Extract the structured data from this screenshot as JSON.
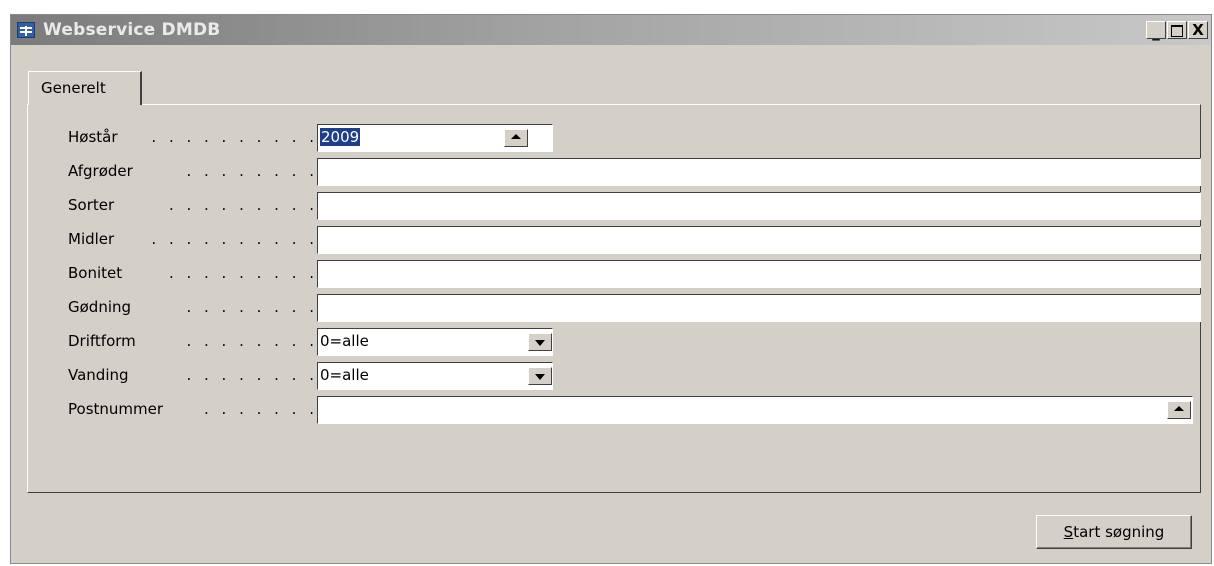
{
  "window": {
    "title": "Webservice DMDB",
    "controls": {
      "minimize": "_",
      "maximize": "□",
      "close": "X"
    }
  },
  "tabs": [
    {
      "label": "Generelt",
      "active": true
    }
  ],
  "form": {
    "hostaar": {
      "label": "Høstår",
      "value": "2009"
    },
    "afgroder": {
      "label": "Afgrøder",
      "value": ""
    },
    "sorter": {
      "label": "Sorter",
      "value": ""
    },
    "midler": {
      "label": "Midler",
      "value": ""
    },
    "bonitet": {
      "label": "Bonitet",
      "value": ""
    },
    "godning": {
      "label": "Gødning",
      "value": ""
    },
    "driftform": {
      "label": "Driftform",
      "value": "0=alle"
    },
    "vanding": {
      "label": "Vanding",
      "value": "0=alle"
    },
    "postnummer": {
      "label": "Postnummer",
      "value": ""
    }
  },
  "footer": {
    "start_button": {
      "accel": "S",
      "rest": "tart søgning"
    }
  },
  "icons": {
    "lookup": "lookup-arrow-icon",
    "dropdown": "chevron-down-icon"
  }
}
